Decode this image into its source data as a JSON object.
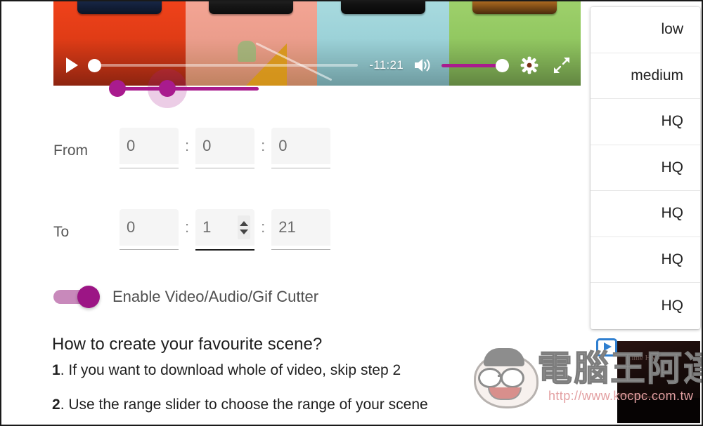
{
  "player": {
    "play_button": "play",
    "time_remaining": "-11:21",
    "volume_icon": "volume-high-icon",
    "settings_icon": "gear-icon",
    "fullscreen_icon": "expand-icon",
    "seek_position_percent": 2,
    "volume_level_percent": 100,
    "thumbnail_panels": [
      "orange-red",
      "salmon",
      "cyan",
      "green"
    ]
  },
  "range_slider": {
    "name": "cutter-range-slider",
    "start_percent": 3,
    "end_percent": 34
  },
  "time_fields": {
    "from": {
      "label": "From",
      "hours": "0",
      "minutes": "0",
      "seconds": "0",
      "separator": ":"
    },
    "to": {
      "label": "To",
      "hours": "0",
      "minutes": "1",
      "seconds": "21",
      "separator": ":",
      "focused_field": "minutes"
    }
  },
  "cutter_toggle": {
    "label": "Enable Video/Audio/Gif Cutter",
    "state": "on",
    "accent_color": "#9c1585",
    "track_color": "#c889bb"
  },
  "howto": {
    "title": "How to create your favourite scene?",
    "steps": [
      {
        "num": "1",
        "dot": ".",
        "text": " If you want to download whole of video, skip step 2"
      },
      {
        "num": "2",
        "dot": ".",
        "text": " Use the range slider to choose the range of your scene"
      }
    ]
  },
  "quality_menu": {
    "items": [
      {
        "label": "low"
      },
      {
        "label": "medium"
      },
      {
        "label": "HQ"
      },
      {
        "label": "HQ"
      },
      {
        "label": "HQ"
      },
      {
        "label": "HQ"
      },
      {
        "label": "HQ"
      }
    ]
  },
  "watermark": {
    "site_name_cn": "電腦王阿達",
    "url": "http://www.kocpc.com.tw",
    "play_icon": "play-badge-icon"
  },
  "corner_thumb": {
    "overlay_text": "Time HM-"
  }
}
